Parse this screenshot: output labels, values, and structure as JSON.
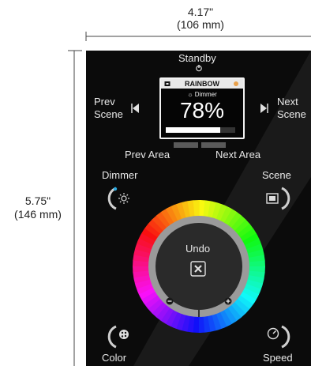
{
  "dimensions": {
    "width_in": "4.17\"",
    "width_mm": "(106 mm)",
    "height_in": "5.75\"",
    "height_mm": "(146 mm)"
  },
  "controller": {
    "standby_label": "Standby",
    "prev_scene_line1": "Prev",
    "prev_scene_line2": "Scene",
    "next_scene_line1": "Next",
    "next_scene_line2": "Scene",
    "prev_area_label": "Prev Area",
    "next_area_label": "Next Area",
    "dimmer_label": "Dimmer",
    "scene_label": "Scene",
    "undo_label": "Undo",
    "color_label": "Color",
    "speed_label": "Speed"
  },
  "screen": {
    "scene_name": "RAINBOW",
    "mode": "Dimmer",
    "value": "78%",
    "level": 0.78
  },
  "colors": {
    "panel": "#0b0b0b",
    "ring_outer": "#9a9a9a",
    "wheel_center": "#2a2a2a",
    "dimmer_accent": "#2aa9e0"
  },
  "icons": {
    "standby": "power-icon",
    "prev_scene": "triangle-left-icon",
    "next_scene": "triangle-right-icon",
    "dimmer": "sun-icon",
    "scene": "film-icon",
    "undo": "x-icon",
    "minus": "minus-icon",
    "plus": "plus-icon",
    "color": "palette-icon",
    "speed": "speedometer-icon"
  }
}
